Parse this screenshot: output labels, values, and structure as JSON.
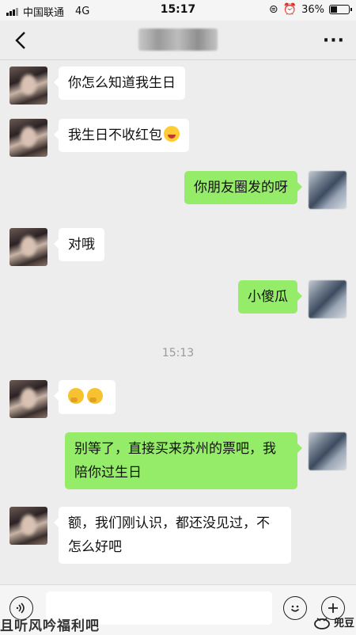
{
  "status_bar": {
    "carrier": "中国联通",
    "network": "4G",
    "time": "15:17",
    "battery_percent": "36%",
    "battery_level": 0.36
  },
  "nav": {
    "back_icon": "chevron-left-icon",
    "more_icon": "more-dots-icon",
    "more_label": "···"
  },
  "messages": [
    {
      "side": "in",
      "text": "你怎么知道我生日"
    },
    {
      "side": "in",
      "text": "我生日不收红包"
    },
    {
      "side": "out",
      "text": "你朋友圈发的呀"
    },
    {
      "side": "in",
      "text": "对哦"
    },
    {
      "side": "out",
      "text": "小傻瓜"
    },
    {
      "side": "in",
      "text": ""
    },
    {
      "side": "out",
      "text": "别等了，直接买来苏州的票吧，我陪你过生日"
    },
    {
      "side": "in",
      "text": "额，我们刚认识，都还没见过，不怎么好吧"
    }
  ],
  "timestamp": "15:13",
  "input_bar": {
    "voice_icon": "voice-icon",
    "emoji_icon": "emoji-icon",
    "plus_icon": "plus-icon"
  },
  "watermark": "且听风吟福利吧",
  "logo_text": "兜豆",
  "colors": {
    "outgoing_bubble": "#95ec69",
    "incoming_bubble": "#ffffff",
    "background": "#ededed"
  }
}
